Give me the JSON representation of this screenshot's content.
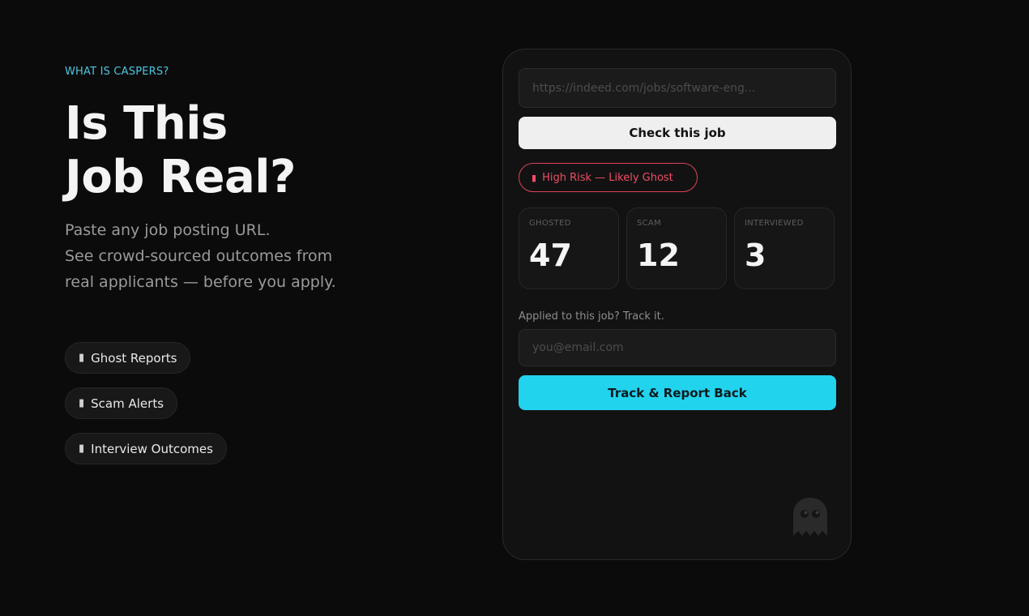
{
  "hero": {
    "eyebrow": "WHAT IS CASPERS?",
    "title_line1": "Is This",
    "title_line2": "Job Real?",
    "subtitle_line1": "Paste any job posting URL.",
    "subtitle_line2": "See crowd-sourced outcomes from",
    "subtitle_line3": "real applicants — before you apply."
  },
  "features": [
    {
      "label": "Ghost Reports",
      "icon": "ghost-icon"
    },
    {
      "label": "Scam Alerts",
      "icon": "warning-icon"
    },
    {
      "label": "Interview Outcomes",
      "icon": "briefcase-icon"
    }
  ],
  "checker": {
    "url_placeholder": "https://indeed.com/jobs/software-eng...",
    "check_label": "Check this job",
    "risk_label": "High Risk — Likely Ghost",
    "risk_icon": "alert-icon",
    "risk_color": "#ef4d66",
    "stats": [
      {
        "label": "GHOSTED",
        "value": "47"
      },
      {
        "label": "SCAM",
        "value": "12"
      },
      {
        "label": "INTERVIEWED",
        "value": "3"
      }
    ],
    "track_prompt": "Applied to this job? Track it.",
    "email_placeholder": "you@email.com",
    "track_label": "Track & Report Back"
  },
  "colors": {
    "accent": "#22d3ee",
    "eyebrow": "#4cc7e0",
    "background": "#0b0b0b",
    "card": "#121212",
    "danger": "#e0425a"
  }
}
